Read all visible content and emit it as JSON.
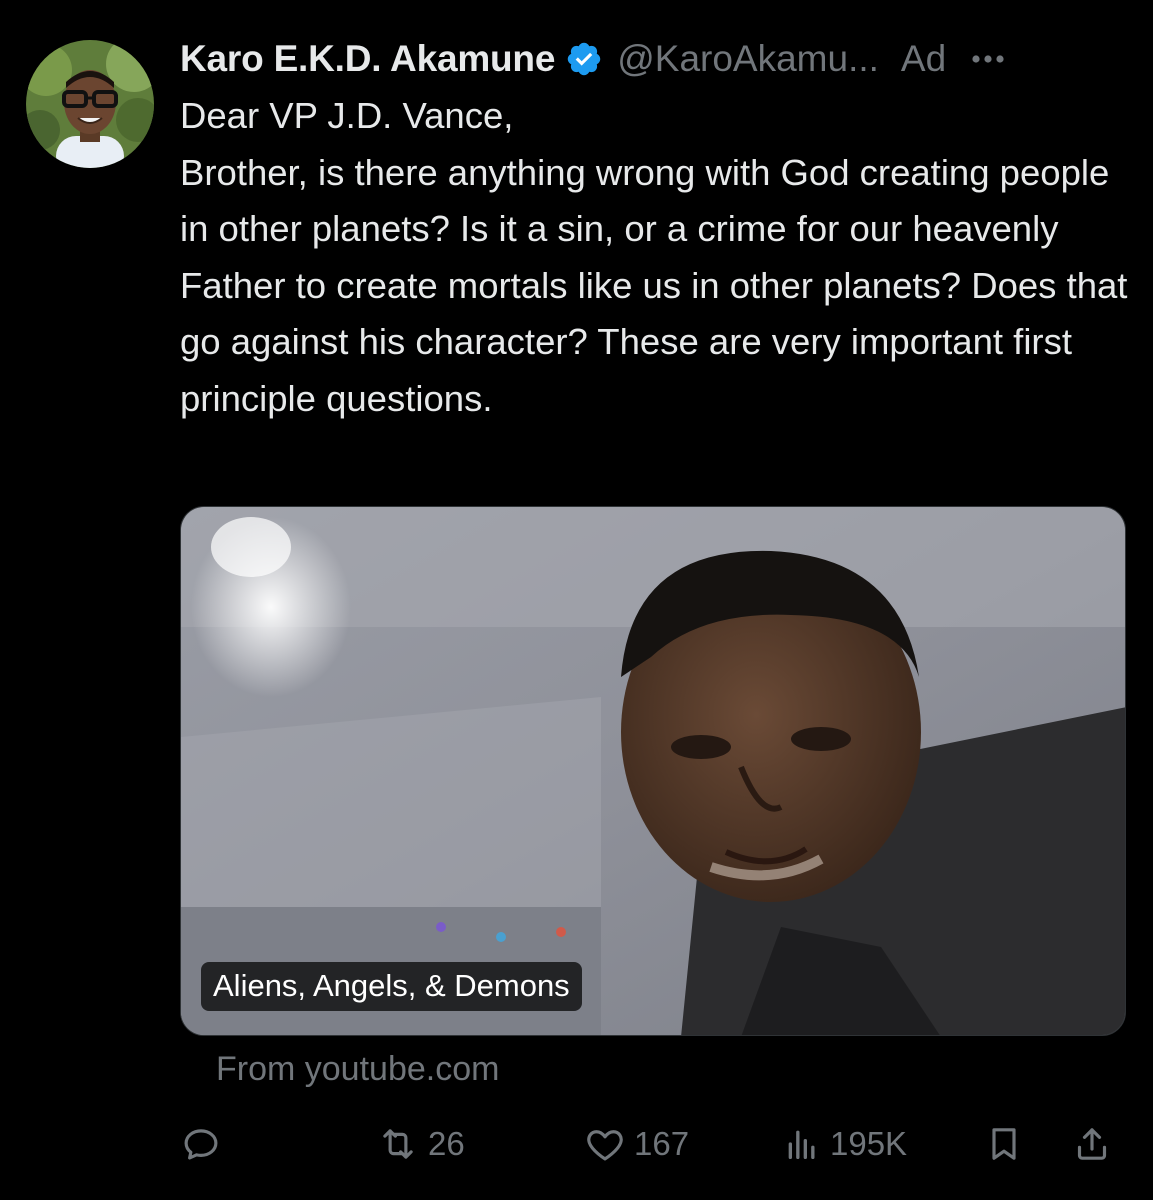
{
  "author": {
    "name": "Karo E.K.D. Akamune",
    "handle": "@KaroAkamu...",
    "verified": true,
    "ad_label": "Ad"
  },
  "tweet": {
    "text": "Dear VP J.D. Vance,\nBrother, is there anything wrong with God creating people in other planets? Is it a sin, or a crime for our heavenly Father to create mortals like us in other planets? Does that go against his character? These are very important first principle questions."
  },
  "media": {
    "caption": "Aliens, Angels, & Demons",
    "source": "From youtube.com"
  },
  "actions": {
    "reposts": "26",
    "likes": "167",
    "views": "195K"
  },
  "colors": {
    "background": "#000000",
    "text_primary": "#e7e9ea",
    "text_secondary": "#71767b",
    "verified_blue": "#1d9bf0"
  }
}
